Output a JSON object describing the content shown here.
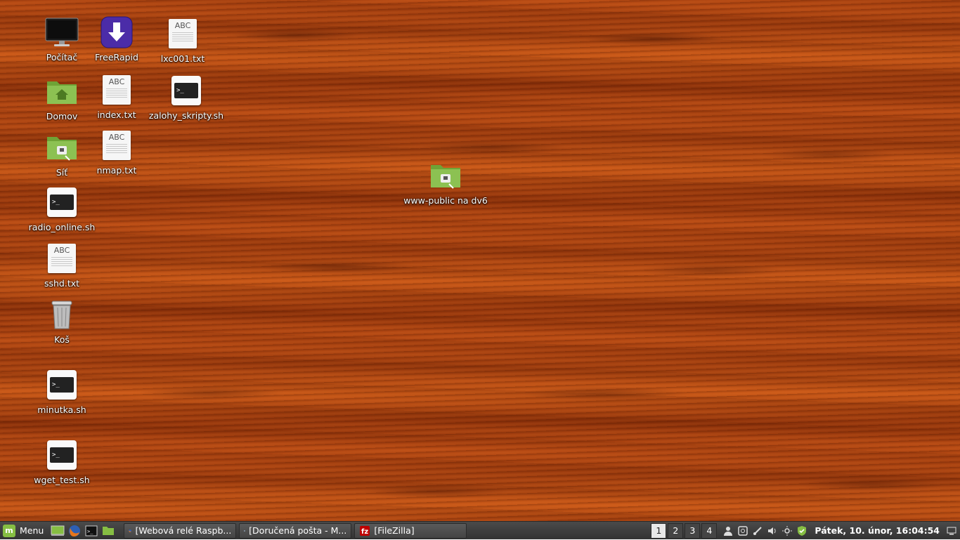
{
  "desktop": {
    "icons": [
      {
        "label": "Počítač",
        "icon": "computer-icon"
      },
      {
        "label": "FreeRapid",
        "icon": "freerapid-download-icon"
      },
      {
        "label": "lxc001.txt",
        "icon": "text-file-icon"
      },
      {
        "label": "Domov",
        "icon": "home-folder-icon"
      },
      {
        "label": "index.txt",
        "icon": "text-file-icon"
      },
      {
        "label": "zalohy_skripty.sh",
        "icon": "terminal-script-icon"
      },
      {
        "label": "Síť",
        "icon": "network-folder-icon"
      },
      {
        "label": "nmap.txt",
        "icon": "text-file-icon"
      },
      {
        "label": "www-public na dv6",
        "icon": "network-share-folder-icon"
      },
      {
        "label": "radio_online.sh",
        "icon": "terminal-script-icon"
      },
      {
        "label": "sshd.txt",
        "icon": "text-file-icon"
      },
      {
        "label": "Koš",
        "icon": "trash-icon"
      },
      {
        "label": "minutka.sh",
        "icon": "terminal-script-icon"
      },
      {
        "label": "wget_test.sh",
        "icon": "terminal-script-icon"
      }
    ],
    "text_file_badge": "ABC",
    "terminal_prompt": ">_"
  },
  "taskbar": {
    "menu_label": "Menu",
    "launchers": [
      "show-desktop-icon",
      "firefox-icon",
      "terminal-icon",
      "files-icon"
    ],
    "tasks": [
      {
        "label": "[Webová relé Raspb...",
        "icon": "firefox-icon"
      },
      {
        "label": "[Doručená pošta - M...",
        "icon": "mail-icon"
      },
      {
        "label": "[FileZilla]",
        "icon": "filezilla-icon"
      }
    ],
    "workspaces": [
      "1",
      "2",
      "3",
      "4"
    ],
    "active_workspace": "1",
    "tray": [
      "user-icon",
      "screenshot-icon",
      "network-icon",
      "volume-icon",
      "brightness-icon",
      "update-shield-icon"
    ],
    "clock": "Pátek, 10. únor, 16:04:54",
    "show_desktop": "show-desktop-icon"
  },
  "colors": {
    "wood": "#b24712",
    "taskbar": "#3d3d3d",
    "folder_green": "#86be43",
    "freerapid_purple": "#4b2ca8"
  }
}
